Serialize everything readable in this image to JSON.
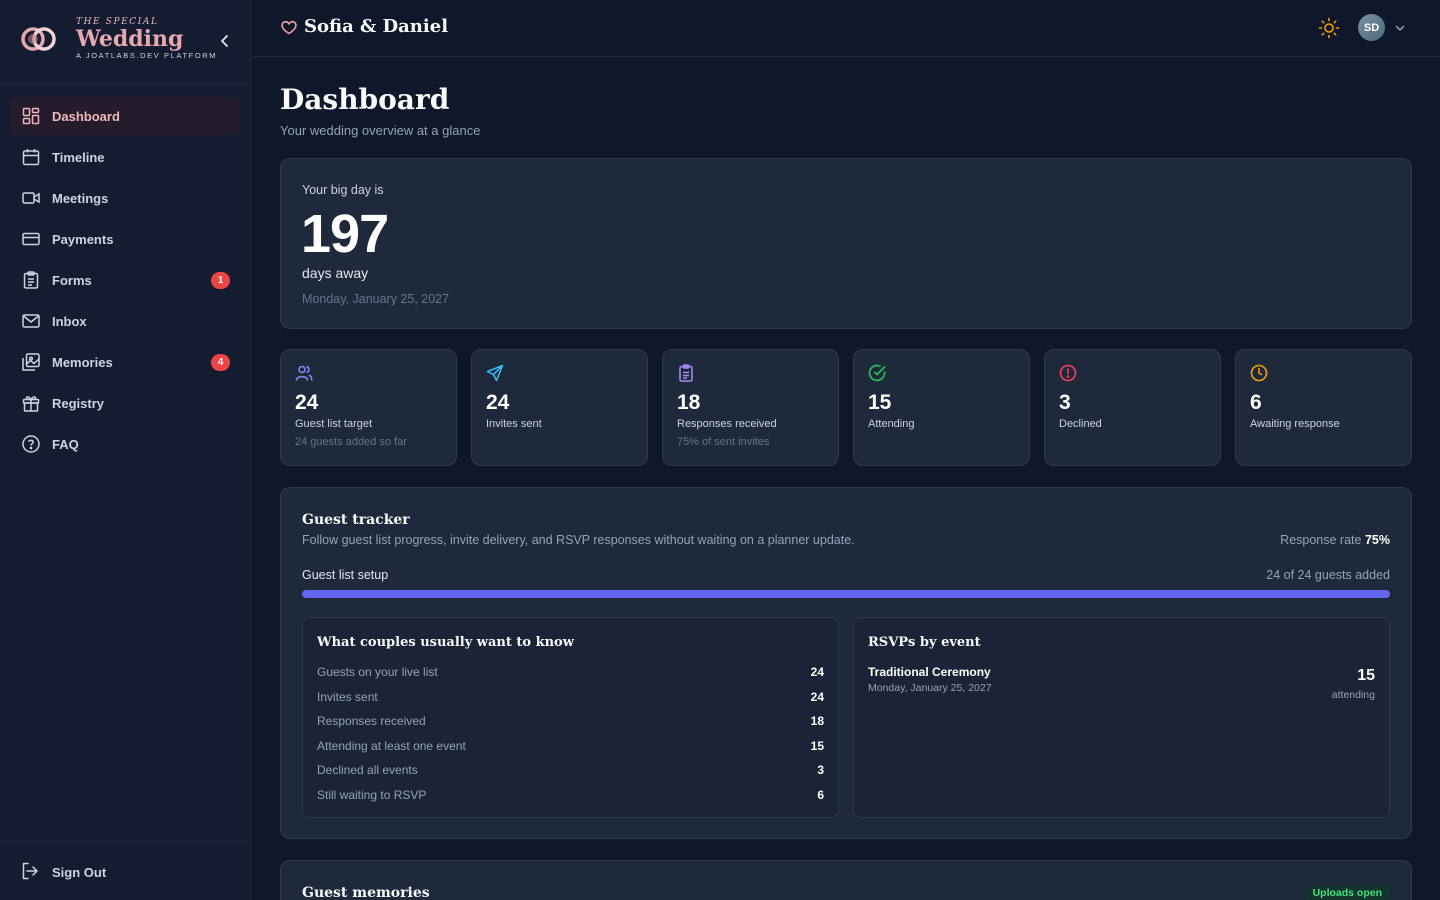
{
  "brand": {
    "small": "THE SPECIAL",
    "big": "Wedding",
    "platform": "A JOATLABS.DEV PLATFORM"
  },
  "sidebar": {
    "items": [
      {
        "label": "Dashboard",
        "icon": "dashboard-icon",
        "active": true
      },
      {
        "label": "Timeline",
        "icon": "calendar-icon"
      },
      {
        "label": "Meetings",
        "icon": "video-icon"
      },
      {
        "label": "Payments",
        "icon": "credit-card-icon"
      },
      {
        "label": "Forms",
        "icon": "clipboard-icon",
        "badge": "1"
      },
      {
        "label": "Inbox",
        "icon": "mail-icon"
      },
      {
        "label": "Memories",
        "icon": "images-icon",
        "badge": "4"
      },
      {
        "label": "Registry",
        "icon": "gift-icon"
      },
      {
        "label": "FAQ",
        "icon": "help-circle-icon"
      }
    ],
    "signout": "Sign Out"
  },
  "header": {
    "couple": "Sofia & Daniel",
    "avatar_initials": "SD"
  },
  "page": {
    "title": "Dashboard",
    "subtitle": "Your wedding overview at a glance"
  },
  "countdown": {
    "label": "Your big day is",
    "days": "197",
    "unit": "days away",
    "date": "Monday, January 25, 2027"
  },
  "stats": [
    {
      "value": "24",
      "label": "Guest list target",
      "sub": "24 guests added so far",
      "icon": "users-icon",
      "color": "#818cf8"
    },
    {
      "value": "24",
      "label": "Invites sent",
      "sub": "",
      "icon": "send-icon",
      "color": "#38bdf8"
    },
    {
      "value": "18",
      "label": "Responses received",
      "sub": "75% of sent invites",
      "icon": "clipboard-list-icon",
      "color": "#a78bfa"
    },
    {
      "value": "15",
      "label": "Attending",
      "sub": "",
      "icon": "check-circle-icon",
      "color": "#22c55e"
    },
    {
      "value": "3",
      "label": "Declined",
      "sub": "",
      "icon": "alert-circle-icon",
      "color": "#f43f5e"
    },
    {
      "value": "6",
      "label": "Awaiting response",
      "sub": "",
      "icon": "clock-icon",
      "color": "#f59e0b"
    }
  ],
  "tracker": {
    "title": "Guest tracker",
    "description": "Follow guest list progress, invite delivery, and RSVP responses without waiting on a planner update.",
    "rate_label": "Response rate",
    "rate_value": "75%",
    "setup_label": "Guest list setup",
    "setup_count": "24 of 24 guests added",
    "setup_progress": 1.0,
    "faq": {
      "title": "What couples usually want to know",
      "rows": [
        {
          "label": "Guests on your live list",
          "value": "24"
        },
        {
          "label": "Invites sent",
          "value": "24"
        },
        {
          "label": "Responses received",
          "value": "18"
        },
        {
          "label": "Attending at least one event",
          "value": "15"
        },
        {
          "label": "Declined all events",
          "value": "3"
        },
        {
          "label": "Still waiting to RSVP",
          "value": "6"
        }
      ]
    },
    "rsvps": {
      "title": "RSVPs by event",
      "events": [
        {
          "name": "Traditional Ceremony",
          "date": "Monday, January 25, 2027",
          "count": "15",
          "unit": "attending"
        }
      ]
    }
  },
  "memories": {
    "title": "Guest memories",
    "badge": "Uploads open"
  },
  "colors": {
    "accent": "#6366f1",
    "brand_pink": "#e7a8b0",
    "badge_red": "#ef4444"
  }
}
